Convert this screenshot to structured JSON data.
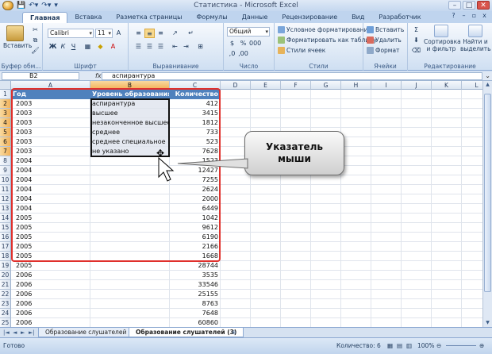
{
  "window": {
    "title": "Статистика - Microsoft Excel",
    "controls": [
      "–",
      "□",
      "✕"
    ]
  },
  "ribbon_tabs": [
    "Главная",
    "Вставка",
    "Разметка страницы",
    "Формулы",
    "Данные",
    "Рецензирование",
    "Вид",
    "Разработчик"
  ],
  "active_tab": "Главная",
  "ribbon": {
    "clipboard": {
      "label": "Буфер обм...",
      "paste": "Вставить"
    },
    "font": {
      "label": "Шрифт",
      "font_name": "Calibri",
      "font_size": "11",
      "bold": "Ж",
      "italic": "К",
      "underline": "Ч"
    },
    "alignment": {
      "label": "Выравнивание"
    },
    "number": {
      "label": "Число",
      "format": "Общий"
    },
    "styles": {
      "label": "Стили",
      "conditional": "Условное форматирование",
      "as_table": "Форматировать как таблицу",
      "cell_styles": "Стили ячеек"
    },
    "cells": {
      "label": "Ячейки",
      "insert": "Вставить",
      "delete": "Удалить",
      "format": "Формат"
    },
    "editing": {
      "label": "Редактирование",
      "sort": "Сортировка и фильтр",
      "find": "Найти и выделить"
    }
  },
  "formula_bar": {
    "name_box": "B2",
    "fx": "fx",
    "value": "аспирантура"
  },
  "columns": [
    "A",
    "B",
    "C",
    "D",
    "E",
    "F",
    "G",
    "H",
    "I",
    "J",
    "K",
    "L"
  ],
  "rows": [
    "1",
    "2",
    "3",
    "4",
    "5",
    "6",
    "7",
    "8",
    "9",
    "10",
    "11",
    "12",
    "13",
    "14",
    "15",
    "16",
    "17",
    "18",
    "19",
    "20",
    "21",
    "22",
    "23",
    "24",
    "25",
    "26"
  ],
  "table": {
    "headers": [
      "Год",
      "Уровень образования",
      "Количество"
    ],
    "data": [
      [
        "2003",
        "аспирантура",
        "412"
      ],
      [
        "2003",
        "высшее",
        "3415"
      ],
      [
        "2003",
        "незаконченное высшее",
        "1812"
      ],
      [
        "2003",
        "среднее",
        "733"
      ],
      [
        "2003",
        "среднее специальное",
        "523"
      ],
      [
        "2003",
        "не указано",
        "7628"
      ],
      [
        "2004",
        "",
        "1523"
      ],
      [
        "2004",
        "",
        "12427"
      ],
      [
        "2004",
        "",
        "7255"
      ],
      [
        "2004",
        "",
        "2624"
      ],
      [
        "2004",
        "",
        "2000"
      ],
      [
        "2004",
        "",
        "6449"
      ],
      [
        "2005",
        "",
        "1042"
      ],
      [
        "2005",
        "",
        "9612"
      ],
      [
        "2005",
        "",
        "6190"
      ],
      [
        "2005",
        "",
        "2166"
      ],
      [
        "2005",
        "",
        "1668"
      ],
      [
        "2005",
        "",
        "28744"
      ],
      [
        "2006",
        "",
        "3535"
      ],
      [
        "2006",
        "",
        "33546"
      ],
      [
        "2006",
        "",
        "25155"
      ],
      [
        "2006",
        "",
        "8763"
      ],
      [
        "2006",
        "",
        "7648"
      ],
      [
        "2006",
        "",
        "60860"
      ]
    ]
  },
  "callout": {
    "line1": "Указатель",
    "line2": "мыши"
  },
  "sheet_tabs": [
    "Образование слушателей (2)",
    "Образование слушателей (3)"
  ],
  "active_sheet": "Образование слушателей (3)",
  "status": {
    "ready": "Готово",
    "count": "Количество: 6",
    "zoom": "100%"
  },
  "colors": {
    "header_fill": "#4f81bd",
    "frame": "#e0302c",
    "selection_fill": "#e5e9f1"
  }
}
